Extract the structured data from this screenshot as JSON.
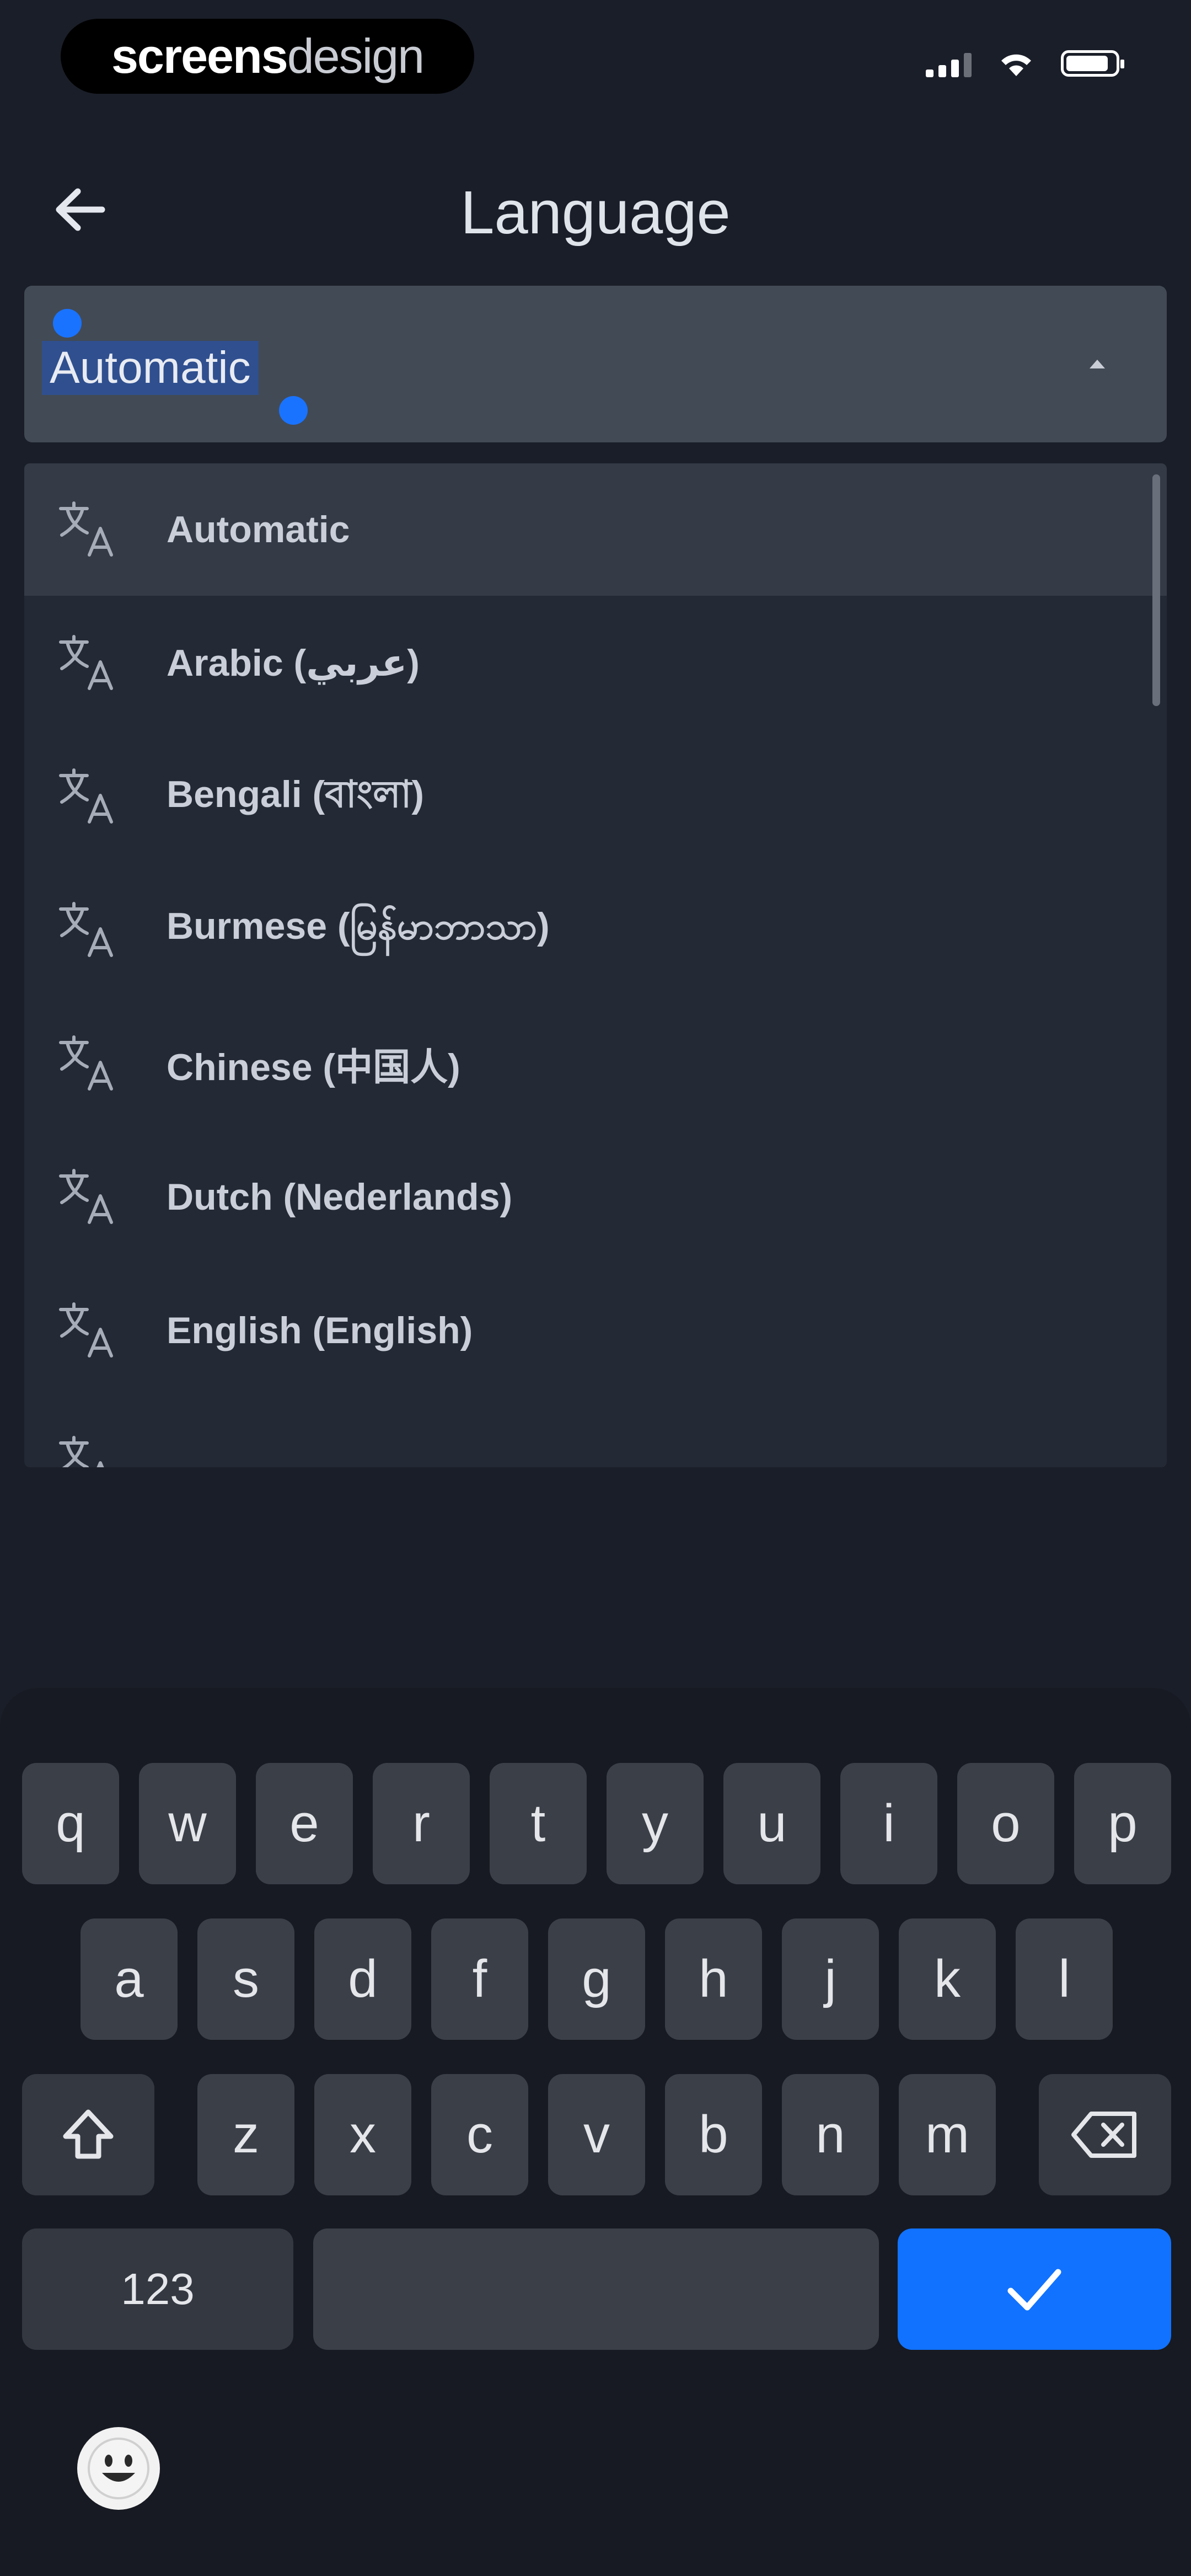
{
  "status_bar": {
    "watermark_part1": "screens",
    "watermark_part2": "design",
    "icons": [
      "cellular-signal-icon",
      "wifi-icon",
      "battery-icon"
    ]
  },
  "header": {
    "title": "Language",
    "back_icon": "arrow-left-icon"
  },
  "select": {
    "value": "Automatic",
    "chevron_icon": "chevron-up-icon"
  },
  "dropdown": {
    "items": [
      {
        "label": "Automatic",
        "icon": "translate-icon",
        "selected": true
      },
      {
        "label": "Arabic (عربي)",
        "icon": "translate-icon",
        "selected": false
      },
      {
        "label": "Bengali (বাংলা)",
        "icon": "translate-icon",
        "selected": false
      },
      {
        "label": "Burmese (မြန်မာဘာသာ)",
        "icon": "translate-icon",
        "selected": false
      },
      {
        "label": "Chinese (中国人)",
        "icon": "translate-icon",
        "selected": false
      },
      {
        "label": "Dutch (Nederlands)",
        "icon": "translate-icon",
        "selected": false
      },
      {
        "label": "English (English)",
        "icon": "translate-icon",
        "selected": false
      }
    ]
  },
  "keyboard": {
    "row1": [
      "q",
      "w",
      "e",
      "r",
      "t",
      "y",
      "u",
      "i",
      "o",
      "p"
    ],
    "row2": [
      "a",
      "s",
      "d",
      "f",
      "g",
      "h",
      "j",
      "k",
      "l"
    ],
    "row3": [
      "z",
      "x",
      "c",
      "v",
      "b",
      "n",
      "m"
    ],
    "numbers_key": "123",
    "done_icon": "checkmark-icon",
    "shift_icon": "shift-icon",
    "backspace_icon": "backspace-icon",
    "emoji_icon": "emoji-icon"
  },
  "colors": {
    "background": "#1a1e28",
    "accent": "#1172ff",
    "field": "#424a55"
  }
}
